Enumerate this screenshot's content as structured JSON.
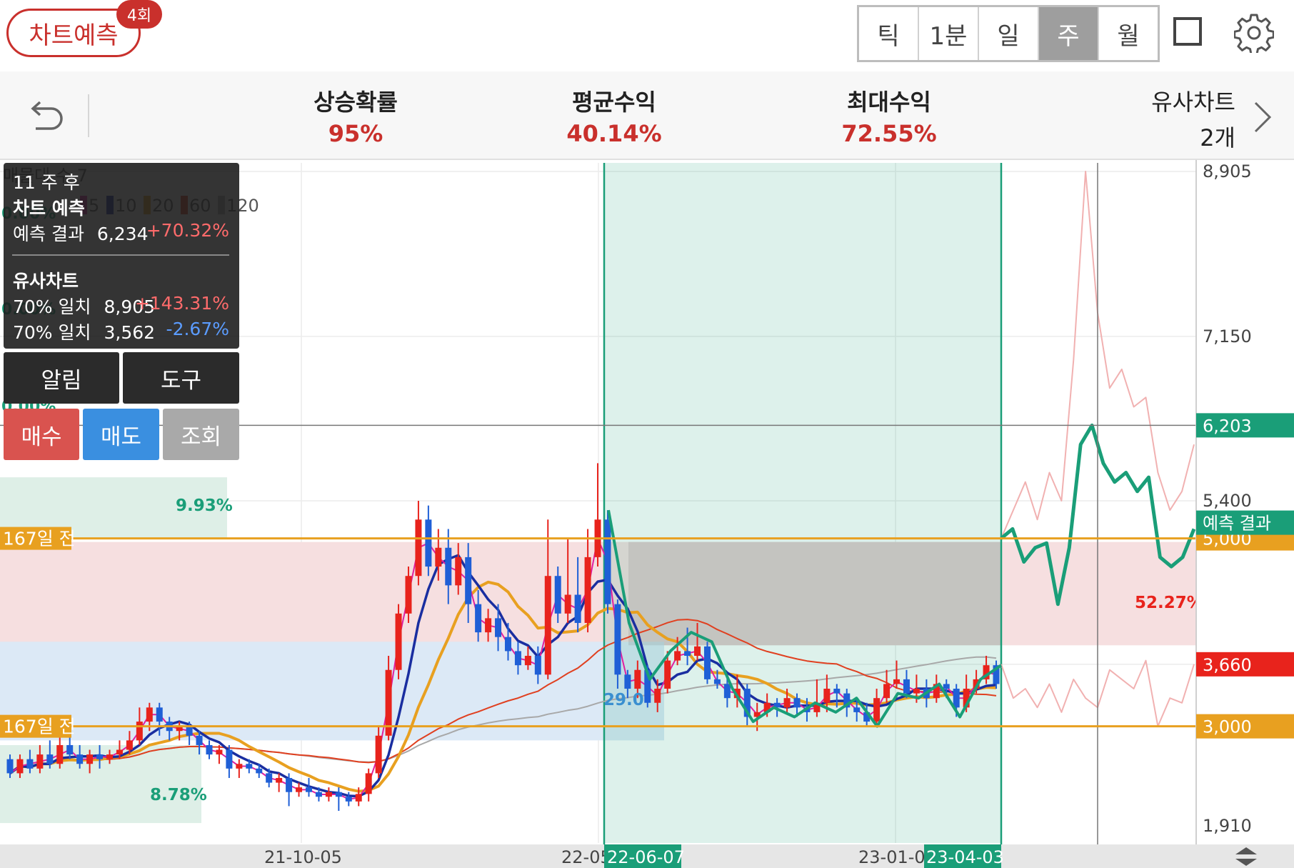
{
  "header": {
    "predict_label": "차트예측",
    "predict_badge": "4회",
    "periods": [
      "틱",
      "1분",
      "일",
      "주",
      "월"
    ],
    "active_period": "주"
  },
  "stats": {
    "rise_prob_label": "상승확률",
    "rise_prob_value": "95%",
    "avg_return_label": "평균수익",
    "avg_return_value": "40.14%",
    "max_return_label": "최대수익",
    "max_return_value": "72.55%",
    "similar_label": "유사차트",
    "similar_value": "2개"
  },
  "overlay": {
    "weeks_after": "11 주 후",
    "chart_predict": "차트 예측",
    "result_label": "예측 결과",
    "result_price": "6,234",
    "result_pct": "+70.32%",
    "similar_label": "유사차트",
    "sim1_label": "70% 일치",
    "sim1_price": "8,905",
    "sim1_pct": "+143.31%",
    "sim2_label": "70% 일치",
    "sim2_price": "3,562",
    "sim2_pct": "-2.67%",
    "alert_label": "알림",
    "tool_label": "도구",
    "buy_label": "매수",
    "sell_label": "매도",
    "view_label": "조회"
  },
  "colors": {
    "up": "#e8231c",
    "down": "#1f5fd6",
    "predict": "#1a9e78",
    "ma5": "#e01fa0",
    "ma10": "#1a2ea0",
    "ma20": "#e8a020",
    "ma60": "#e04020",
    "ma120": "#a8a8a8",
    "accent": "#c9302c"
  },
  "chart_data": {
    "type": "candlestick",
    "period": "weekly",
    "legend_fragments": [
      "매물대 수 7",
      "5",
      "10",
      "20",
      "60",
      "120"
    ],
    "y_axis": {
      "min": 1910,
      "max": 8905,
      "ticks": [
        8905,
        7150,
        5400,
        1910
      ]
    },
    "x_ticks": [
      "21-10-05",
      "22-05",
      "23-01-0"
    ],
    "highlighted_dates": [
      "22-06-07",
      "23-04-03"
    ],
    "price_tags": [
      {
        "label": "6,203",
        "value": 6203,
        "color": "#1a9e78"
      },
      {
        "label": "5,000",
        "value": 5000,
        "color": "#e8a020"
      },
      {
        "label": "3,660",
        "value": 3660,
        "color": "#e8231c"
      },
      {
        "label": "3,000",
        "value": 3000,
        "color": "#e8a020"
      }
    ],
    "prediction_tag": "예측 결과",
    "level_lines": [
      {
        "label": "167일 전",
        "value": 5000
      },
      {
        "label": "167일 전",
        "value": 3000
      }
    ],
    "zone_labels": [
      {
        "text": "9.93%",
        "color": "#1a9e78"
      },
      {
        "text": "8.78%",
        "color": "#1a9e78"
      },
      {
        "text": "29.0",
        "color": "#3a8fd0"
      },
      {
        "text": "52.27%",
        "color": "#e8231c"
      }
    ],
    "left_pct_fragments": [
      "0.00%",
      "0.00%",
      "0.00%"
    ],
    "candles": [
      [
        2650,
        2500,
        2700,
        2450
      ],
      [
        2500,
        2650,
        2700,
        2450
      ],
      [
        2650,
        2550,
        2750,
        2500
      ],
      [
        2550,
        2700,
        2800,
        2500
      ],
      [
        2700,
        2600,
        2850,
        2550
      ],
      [
        2600,
        2800,
        2900,
        2550
      ],
      [
        2800,
        2700,
        2950,
        2650
      ],
      [
        2700,
        2600,
        2800,
        2550
      ],
      [
        2600,
        2700,
        2750,
        2500
      ],
      [
        2700,
        2650,
        2800,
        2550
      ],
      [
        2650,
        2700,
        2750,
        2600
      ],
      [
        2700,
        2750,
        2850,
        2650
      ],
      [
        2750,
        2850,
        2950,
        2700
      ],
      [
        2850,
        3050,
        3200,
        2800
      ],
      [
        3050,
        3200,
        3250,
        2950
      ],
      [
        3200,
        3050,
        3250,
        2900
      ],
      [
        3050,
        2950,
        3100,
        2850
      ],
      [
        2950,
        3000,
        3050,
        2850
      ],
      [
        3000,
        2900,
        3050,
        2800
      ],
      [
        2900,
        2800,
        2950,
        2700
      ],
      [
        2800,
        2700,
        2850,
        2650
      ],
      [
        2700,
        2750,
        2800,
        2600
      ],
      [
        2750,
        2550,
        2800,
        2450
      ],
      [
        2550,
        2600,
        2650,
        2450
      ],
      [
        2600,
        2550,
        2650,
        2500
      ],
      [
        2550,
        2500,
        2600,
        2450
      ],
      [
        2500,
        2400,
        2550,
        2350
      ],
      [
        2400,
        2450,
        2500,
        2300
      ],
      [
        2450,
        2300,
        2500,
        2150
      ],
      [
        2300,
        2350,
        2400,
        2250
      ],
      [
        2350,
        2300,
        2450,
        2250
      ],
      [
        2300,
        2250,
        2350,
        2200
      ],
      [
        2250,
        2300,
        2350,
        2200
      ],
      [
        2300,
        2250,
        2350,
        2100
      ],
      [
        2250,
        2200,
        2300,
        2150
      ],
      [
        2200,
        2280,
        2350,
        2150
      ],
      [
        2280,
        2500,
        2550,
        2200
      ],
      [
        2500,
        2900,
        3000,
        2450
      ],
      [
        2900,
        3600,
        3750,
        2850
      ],
      [
        3600,
        4200,
        4300,
        3500
      ],
      [
        4200,
        4600,
        4700,
        4100
      ],
      [
        4600,
        5200,
        5400,
        4500
      ],
      [
        5200,
        4700,
        5350,
        4600
      ],
      [
        4700,
        4900,
        5100,
        4550
      ],
      [
        4900,
        4500,
        5100,
        4300
      ],
      [
        4500,
        4800,
        4950,
        4400
      ],
      [
        4800,
        4300,
        4950,
        4100
      ],
      [
        4300,
        4000,
        4450,
        3900
      ],
      [
        4000,
        4150,
        4250,
        3900
      ],
      [
        4150,
        3950,
        4300,
        3800
      ],
      [
        3950,
        3800,
        4100,
        3700
      ],
      [
        3800,
        3650,
        3900,
        3550
      ],
      [
        3650,
        3750,
        3850,
        3600
      ],
      [
        3750,
        3550,
        3850,
        3450
      ],
      [
        3550,
        4600,
        5200,
        3500
      ],
      [
        4600,
        4200,
        4700,
        4100
      ],
      [
        4200,
        4400,
        5000,
        4100
      ],
      [
        4400,
        4100,
        4800,
        4000
      ],
      [
        4100,
        4800,
        5100,
        4000
      ],
      [
        4800,
        5200,
        5800,
        4700
      ],
      [
        5200,
        4300,
        5300,
        4200
      ],
      [
        4300,
        3550,
        4350,
        3400
      ],
      [
        3550,
        3400,
        3600,
        3300
      ],
      [
        3400,
        3600,
        3700,
        3300
      ],
      [
        3600,
        3250,
        3650,
        3200
      ],
      [
        3250,
        3400,
        3500,
        3150
      ],
      [
        3400,
        3700,
        3800,
        3350
      ],
      [
        3700,
        3800,
        3950,
        3650
      ],
      [
        3800,
        3750,
        4050,
        3650
      ],
      [
        3750,
        3850,
        4100,
        3700
      ],
      [
        3850,
        3500,
        3900,
        3450
      ],
      [
        3500,
        3450,
        3600,
        3400
      ],
      [
        3450,
        3300,
        3550,
        3200
      ],
      [
        3300,
        3400,
        3550,
        3200
      ],
      [
        3400,
        3100,
        3450,
        3000
      ],
      [
        3100,
        3150,
        3250,
        2950
      ],
      [
        3150,
        3250,
        3350,
        3100
      ],
      [
        3250,
        3200,
        3300,
        3100
      ],
      [
        3200,
        3300,
        3400,
        3150
      ],
      [
        3300,
        3200,
        3350,
        3100
      ],
      [
        3200,
        3150,
        3300,
        3050
      ],
      [
        3150,
        3250,
        3500,
        3100
      ],
      [
        3250,
        3400,
        3550,
        3150
      ],
      [
        3400,
        3350,
        3450,
        3200
      ],
      [
        3350,
        3200,
        3400,
        3100
      ],
      [
        3200,
        3150,
        3300,
        3050
      ],
      [
        3150,
        3050,
        3250,
        3000
      ],
      [
        3050,
        3300,
        3400,
        3000
      ],
      [
        3300,
        3450,
        3600,
        3250
      ],
      [
        3450,
        3500,
        3700,
        3400
      ],
      [
        3500,
        3350,
        3600,
        3300
      ],
      [
        3350,
        3400,
        3550,
        3250
      ],
      [
        3400,
        3300,
        3500,
        3200
      ],
      [
        3300,
        3450,
        3550,
        3250
      ],
      [
        3450,
        3400,
        3500,
        3300
      ],
      [
        3400,
        3200,
        3450,
        3100
      ],
      [
        3200,
        3400,
        3550,
        3150
      ],
      [
        3400,
        3500,
        3600,
        3350
      ],
      [
        3500,
        3650,
        3750,
        3450
      ],
      [
        3650,
        3450,
        3700,
        3400
      ]
    ],
    "prediction_path": [
      5000,
      5100,
      4750,
      4900,
      4950,
      4300,
      4900,
      6000,
      6203,
      5800,
      5600,
      5700,
      5500,
      5650,
      4800,
      4700,
      4800,
      5100
    ],
    "similar_upper": [
      5000,
      5300,
      5600,
      5200,
      5700,
      5400,
      6900,
      8905,
      7400,
      6600,
      6800,
      6400,
      6500,
      5700,
      5300,
      5500,
      6000
    ],
    "similar_lower": [
      3660,
      3300,
      3400,
      3200,
      3450,
      3150,
      3500,
      3300,
      3200,
      3600,
      3500,
      3400,
      3700,
      3000,
      3300,
      3250,
      3660
    ]
  }
}
